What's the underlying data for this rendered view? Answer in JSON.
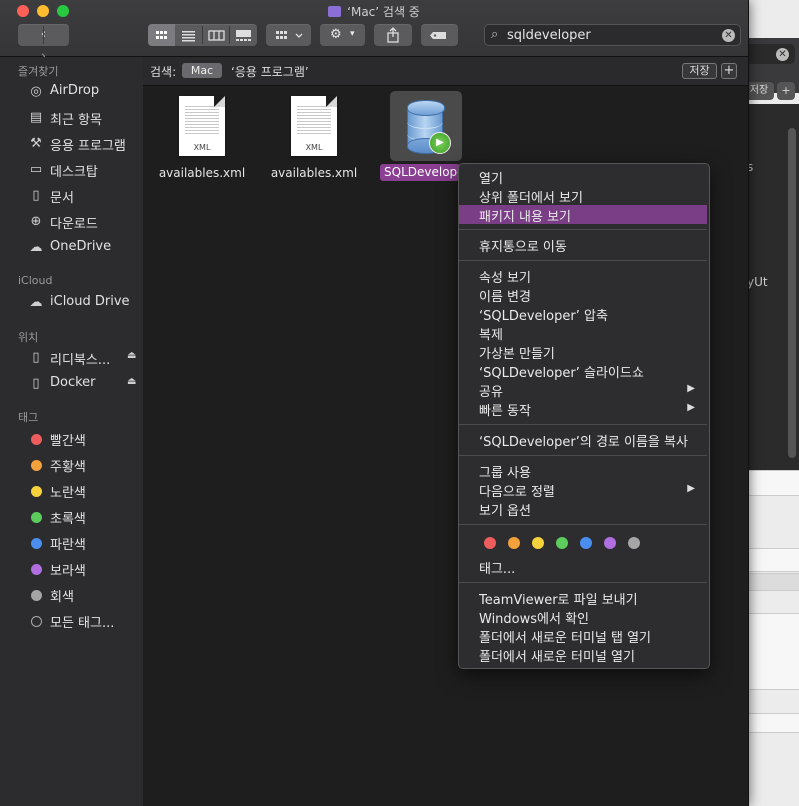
{
  "window": {
    "title": "‘Mac’ 검색 중"
  },
  "toolbar": {
    "back_icon": "chevron-left-icon",
    "forward_icon": "chevron-right-icon",
    "share_icon": "share-icon",
    "gear_icon": "gear-icon",
    "tag_icon": "tag-icon"
  },
  "search": {
    "value": "sqldeveloper"
  },
  "scope": {
    "label": "검색:",
    "mac": "Mac",
    "apps": "‘응용 프로그램’",
    "save": "저장",
    "plus": "+"
  },
  "sidebar": {
    "favorites_header": "즐겨찾기",
    "favorites": [
      {
        "label": "AirDrop",
        "icon": "airdrop-icon"
      },
      {
        "label": "최근 항목",
        "icon": "recents-icon"
      },
      {
        "label": "응용 프로그램",
        "icon": "applications-icon"
      },
      {
        "label": "데스크탑",
        "icon": "desktop-icon"
      },
      {
        "label": "문서",
        "icon": "document-icon"
      },
      {
        "label": "다운로드",
        "icon": "download-icon"
      },
      {
        "label": "OneDrive",
        "icon": "cloud-icon"
      }
    ],
    "icloud_header": "iCloud",
    "icloud": [
      {
        "label": "iCloud Drive",
        "icon": "cloud-icon"
      }
    ],
    "locations_header": "위치",
    "locations": [
      {
        "label": "리디북스...",
        "icon": "disk-icon"
      },
      {
        "label": "Docker",
        "icon": "disk-icon"
      }
    ],
    "tags_header": "태그",
    "tags": [
      {
        "label": "빨간색",
        "color": "#ee5d5d"
      },
      {
        "label": "주황색",
        "color": "#f4a13b"
      },
      {
        "label": "노란색",
        "color": "#f6d33b"
      },
      {
        "label": "초록색",
        "color": "#5ccc5c"
      },
      {
        "label": "파란색",
        "color": "#4a8ff0"
      },
      {
        "label": "보라색",
        "color": "#b06ee0"
      },
      {
        "label": "회색",
        "color": "#a5a5a5"
      },
      {
        "label": "모든 태그...",
        "color": "#2c2c2e"
      }
    ]
  },
  "files": [
    {
      "name": "availables.xml",
      "type": "XML"
    },
    {
      "name": "availables.xml",
      "type": "XML"
    },
    {
      "name": "SQLDeveloper"
    }
  ],
  "menu": {
    "items": [
      "열기",
      "상위 폴더에서 보기",
      "패키지 내용 보기",
      "휴지통으로 이동",
      "속성 보기",
      "이름 변경",
      "‘SQLDeveloper’ 압축",
      "복제",
      "가상본 만들기",
      "‘SQLDeveloper’ 슬라이드쇼",
      "공유",
      "빠른 동작",
      "‘SQLDeveloper’의 경로 이름을 복사",
      "그룹 사용",
      "다음으로 정렬",
      "보기 옵션",
      "태그...",
      "TeamViewer로 파일 보내기",
      "Windows에서 확인",
      "폴더에서 새로운 터미널 탭 열기",
      "폴더에서 새로운 터미널 열기"
    ],
    "tag_colors": [
      "#ee5d5d",
      "#f4a13b",
      "#f6d33b",
      "#5ccc5c",
      "#4a8ff0",
      "#b06ee0",
      "#a5a5a5"
    ]
  },
  "background_window": {
    "save_fragment": "저장",
    "text1": "s",
    "text2": "yUt"
  }
}
